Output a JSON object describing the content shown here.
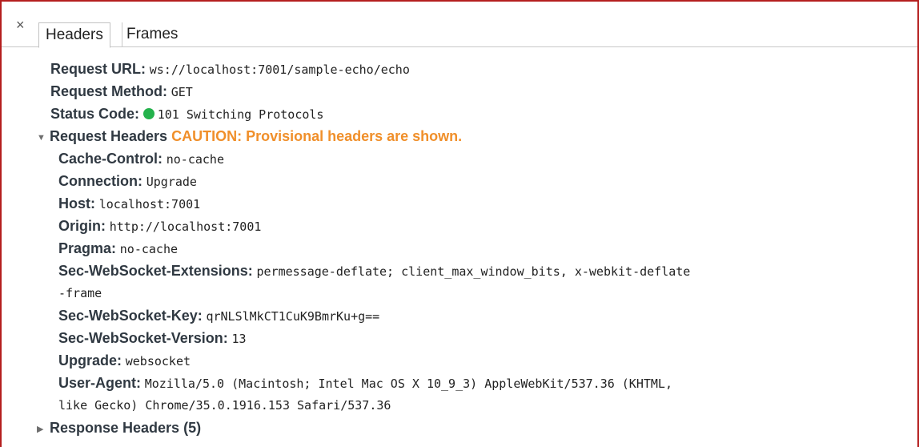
{
  "tabs": {
    "close_glyph": "×",
    "headers_label": "Headers",
    "frames_label": "Frames"
  },
  "general": {
    "request_url_key": "Request URL:",
    "request_url_value": "ws://localhost:7001/sample-echo/echo",
    "request_method_key": "Request Method:",
    "request_method_value": "GET",
    "status_code_key": "Status Code:",
    "status_code_value": "101 Switching Protocols",
    "status_color": "#24b24c"
  },
  "request_headers": {
    "title": "Request Headers",
    "caution": "CAUTION: Provisional headers are shown.",
    "caution_color": "#f08f2a",
    "items": [
      {
        "key": "Cache-Control:",
        "value": "no-cache"
      },
      {
        "key": "Connection:",
        "value": "Upgrade"
      },
      {
        "key": "Host:",
        "value": "localhost:7001"
      },
      {
        "key": "Origin:",
        "value": "http://localhost:7001"
      },
      {
        "key": "Pragma:",
        "value": "no-cache"
      },
      {
        "key": "Sec-WebSocket-Extensions:",
        "value": "permessage-deflate; client_max_window_bits, x-webkit-deflate",
        "continuation": "-frame"
      },
      {
        "key": "Sec-WebSocket-Key:",
        "value": "qrNLSlMkCT1CuK9BmrKu+g=="
      },
      {
        "key": "Sec-WebSocket-Version:",
        "value": "13"
      },
      {
        "key": "Upgrade:",
        "value": "websocket"
      },
      {
        "key": "User-Agent:",
        "value": "Mozilla/5.0 (Macintosh; Intel Mac OS X 10_9_3) AppleWebKit/537.36 (KHTML,",
        "continuation": "like Gecko) Chrome/35.0.1916.153 Safari/537.36"
      }
    ]
  },
  "response_headers": {
    "title": "Response Headers (5)"
  }
}
